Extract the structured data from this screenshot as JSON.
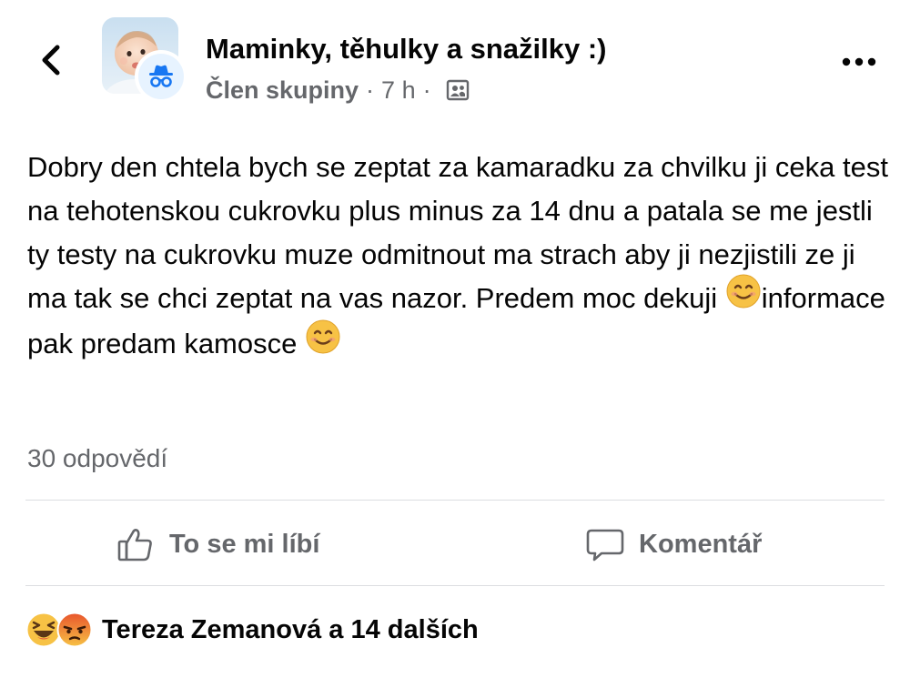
{
  "header": {
    "back_icon": "chevron-left-icon",
    "group_name": "Maminky, těhulky a snažilky :)",
    "author_role": "Člen skupiny",
    "separator": "·",
    "time_ago": "7 h",
    "audience_icon": "group-members-icon",
    "more_icon": "more-options-icon",
    "anonymous_badge_icon": "anonymous-incognito-icon"
  },
  "post": {
    "text_part1": "Dobry den chtela bych se zeptat za kamaradku za chvilku ji ceka test na tehotenskou cukrovku plus minus za 14 dnu a patala se me jestli ty testy na cukrovku muze odmitnout ma strach aby ji nezjistili ze ji ma tak se chci zeptat na vas nazor. Predem moc dekuji ",
    "text_part2": "informace pak predam kamosce ",
    "emoji_name": "smiling-face-icon"
  },
  "stats": {
    "replies": "30 odpovědí"
  },
  "actions": {
    "like_label": "To se mi líbí",
    "comment_label": "Komentář"
  },
  "reactions": {
    "icons": [
      "haha-reaction-icon",
      "angry-reaction-icon"
    ],
    "summary": "Tereza Zemanová a 14 dalších"
  },
  "colors": {
    "text_primary": "#050505",
    "text_secondary": "#65676b",
    "divider": "#dcdde1",
    "accent_blue": "#1877f2",
    "emoji_yellow": "#f7c245",
    "angry_orange": "#e8542c"
  }
}
